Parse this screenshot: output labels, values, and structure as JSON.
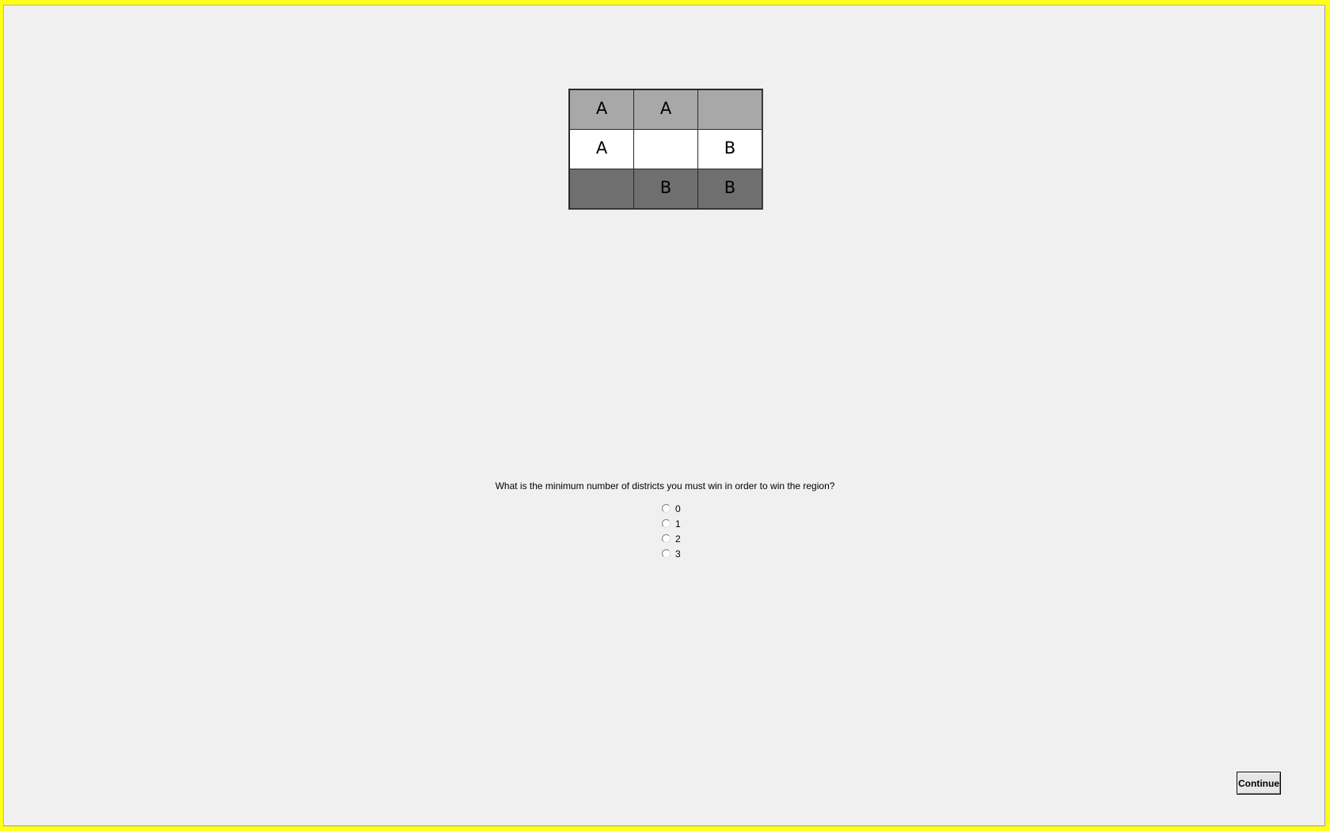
{
  "grid": {
    "rows": [
      [
        {
          "label": "A",
          "shade": "light"
        },
        {
          "label": "A",
          "shade": "light"
        },
        {
          "label": "",
          "shade": "light"
        }
      ],
      [
        {
          "label": "A",
          "shade": "white"
        },
        {
          "label": "",
          "shade": "white"
        },
        {
          "label": "B",
          "shade": "white"
        }
      ],
      [
        {
          "label": "",
          "shade": "dark"
        },
        {
          "label": "B",
          "shade": "dark"
        },
        {
          "label": "B",
          "shade": "dark"
        }
      ]
    ],
    "colors": {
      "light": "#a8a8a8",
      "white": "#ffffff",
      "dark": "#6f6f6f"
    }
  },
  "question": {
    "text": "What is the minimum number of districts you must win in order to win the region?",
    "options": [
      {
        "label": "0",
        "selected": false
      },
      {
        "label": "1",
        "selected": false
      },
      {
        "label": "2",
        "selected": false
      },
      {
        "label": "3",
        "selected": false
      }
    ]
  },
  "footer": {
    "continue_label": "Continue"
  },
  "colors": {
    "window_border": "#ffff1a",
    "background": "#f0f0f0"
  }
}
